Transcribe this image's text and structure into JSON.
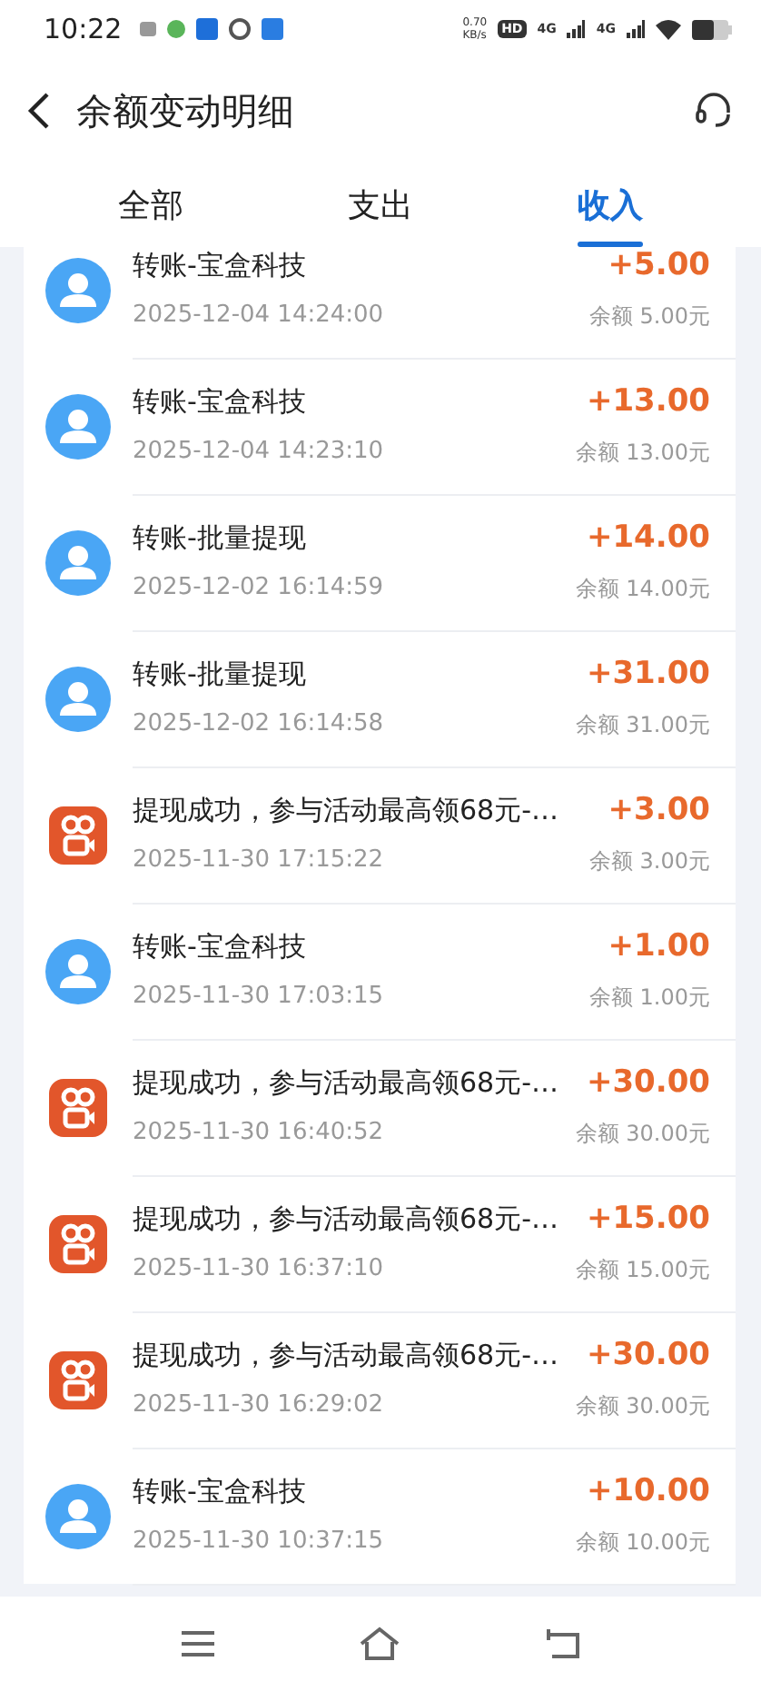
{
  "status_bar": {
    "time": "10:22",
    "speed_value": "0.70",
    "speed_unit": "KB/s",
    "hd": "HD",
    "signals": [
      "4G",
      "4G"
    ]
  },
  "header": {
    "title": "余额变动明细"
  },
  "tabs": [
    {
      "label": "全部",
      "selected": false
    },
    {
      "label": "支出",
      "selected": false
    },
    {
      "label": "收入",
      "selected": true
    }
  ],
  "records": [
    {
      "kind": "person",
      "title": "转账-宝盒科技",
      "time": "2025-12-04 14:24:00",
      "amount": "+5.00",
      "balance": "余额 5.00元"
    },
    {
      "kind": "person",
      "title": "转账-宝盒科技",
      "time": "2025-12-04 14:23:10",
      "amount": "+13.00",
      "balance": "余额 13.00元"
    },
    {
      "kind": "person",
      "title": "转账-批量提现",
      "time": "2025-12-02 16:14:59",
      "amount": "+14.00",
      "balance": "余额 14.00元"
    },
    {
      "kind": "person",
      "title": "转账-批量提现",
      "time": "2025-12-02 16:14:58",
      "amount": "+31.00",
      "balance": "余额 31.00元"
    },
    {
      "kind": "app",
      "title": "提现成功，参与活动最高领68元-…",
      "time": "2025-11-30 17:15:22",
      "amount": "+3.00",
      "balance": "余额 3.00元"
    },
    {
      "kind": "person",
      "title": "转账-宝盒科技",
      "time": "2025-11-30 17:03:15",
      "amount": "+1.00",
      "balance": "余额 1.00元"
    },
    {
      "kind": "app",
      "title": "提现成功，参与活动最高领68元-…",
      "time": "2025-11-30 16:40:52",
      "amount": "+30.00",
      "balance": "余额 30.00元"
    },
    {
      "kind": "app",
      "title": "提现成功，参与活动最高领68元-…",
      "time": "2025-11-30 16:37:10",
      "amount": "+15.00",
      "balance": "余额 15.00元"
    },
    {
      "kind": "app",
      "title": "提现成功，参与活动最高领68元-…",
      "time": "2025-11-30 16:29:02",
      "amount": "+30.00",
      "balance": "余额 30.00元"
    },
    {
      "kind": "person",
      "title": "转账-宝盒科技",
      "time": "2025-11-30 10:37:15",
      "amount": "+10.00",
      "balance": "余额 10.00元"
    }
  ]
}
